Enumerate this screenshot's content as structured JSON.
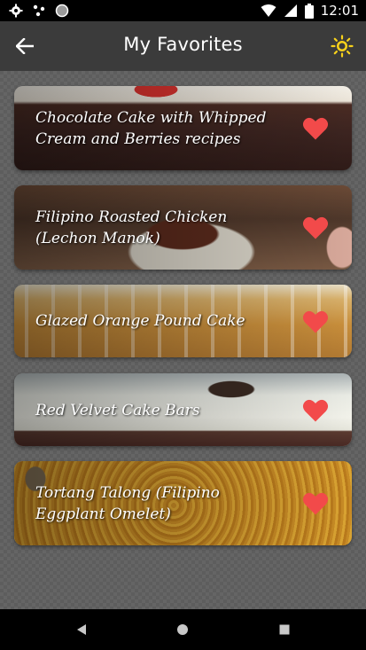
{
  "status_bar": {
    "time": "12:01",
    "icons": [
      "gear-icon",
      "data-dots-icon",
      "circle-icon",
      "wifi-icon",
      "signal-icon",
      "battery-icon"
    ]
  },
  "app_bar": {
    "title": "My Favorites",
    "back_icon": "arrow-left-icon",
    "theme_icon": "sun-icon"
  },
  "colors": {
    "app_bar": "#3b3b3b",
    "background": "#5d5d5d",
    "heart": "#f24a4a",
    "theme_icon": "#f7d11b"
  },
  "favorites": [
    {
      "title": "Chocolate Cake with Whipped Cream and Berries recipes",
      "favorited": true
    },
    {
      "title": "Filipino Roasted Chicken (Lechon Manok)",
      "favorited": true
    },
    {
      "title": "Glazed Orange Pound Cake",
      "favorited": true
    },
    {
      "title": "Red Velvet Cake Bars",
      "favorited": true
    },
    {
      "title": "Tortang Talong (Filipino Eggplant Omelet)",
      "favorited": true
    }
  ],
  "nav_bar": {
    "icons": [
      "back-triangle-icon",
      "home-circle-icon",
      "recents-square-icon"
    ]
  }
}
